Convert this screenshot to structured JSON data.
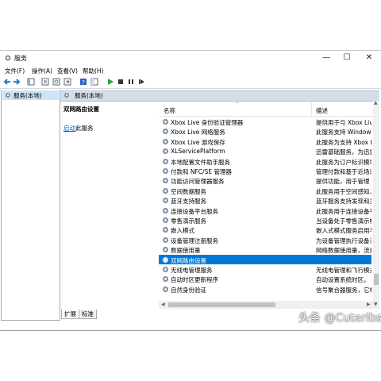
{
  "window": {
    "title": "服务",
    "controls": {
      "minimize": "—",
      "maximize": "☐",
      "close": "✕"
    },
    "accent": "#0078d7"
  },
  "menu": [
    "文件(F)",
    "操作(A)",
    "查看(V)",
    "帮助(H)"
  ],
  "toolbar_icons": [
    "back-arrow-icon",
    "forward-arrow-icon",
    "console-tree-icon",
    "properties-icon",
    "refresh-icon",
    "export-icon",
    "help-icon",
    "show-hide-icon",
    "play-icon",
    "stop-icon",
    "pause-icon",
    "restart-icon"
  ],
  "tree": {
    "selected": "服务(本地)"
  },
  "header": {
    "label": "服务(本地)"
  },
  "detail": {
    "service_name": "双网路由设置",
    "action_link": "启动",
    "action_suffix": "此服务"
  },
  "columns": {
    "name": "名称",
    "description": "描述"
  },
  "rows": [
    {
      "name": "Xbox Live 身份验证管理器",
      "desc": "提供用于与 Xbox Live"
    },
    {
      "name": "Xbox Live 网络服务",
      "desc": "此服务支持 Windows."
    },
    {
      "name": "Xbox Live 游戏保存",
      "desc": "此服务为支持 Xbox Live"
    },
    {
      "name": "XLServicePlatform",
      "desc": "迅雷基础服务，为迅雷"
    },
    {
      "name": "本地配置文件助手服务",
      "desc": "此服务为订户标识模块"
    },
    {
      "name": "付款和 NFC/SE 管理器",
      "desc": "管理付款和基于近场通"
    },
    {
      "name": "功能访问管理器服务",
      "desc": "提供功能，用于管理 UW"
    },
    {
      "name": "空间数据服务",
      "desc": "此服务用于空间感知、"
    },
    {
      "name": "蓝牙支持服务",
      "desc": "蓝牙服务支持发现和关"
    },
    {
      "name": "连接设备平台服务",
      "desc": "此服务用于连接设备平"
    },
    {
      "name": "零售演示服务",
      "desc": "当设备处于零售演示模"
    },
    {
      "name": "嵌入模式",
      "desc": "嵌入式模式服务启用与后"
    },
    {
      "name": "设备管理注册服务",
      "desc": "为设备管理执行设备注"
    },
    {
      "name": "数据使用量",
      "desc": "网络数据使用量，流量"
    },
    {
      "name": "双网路由设置",
      "desc": ""
    },
    {
      "name": "无线电管理服务",
      "desc": "无线电管理和飞行模式"
    },
    {
      "name": "自动时区更新程序",
      "desc": "自动设置系统时区。"
    },
    {
      "name": "自然身份验证",
      "desc": "信号聚合器服务，它根"
    }
  ],
  "selected_row_index": 14,
  "tabs": [
    "扩展",
    "标准"
  ],
  "active_tab": "扩展",
  "watermark": "头条 @Cuteribs"
}
